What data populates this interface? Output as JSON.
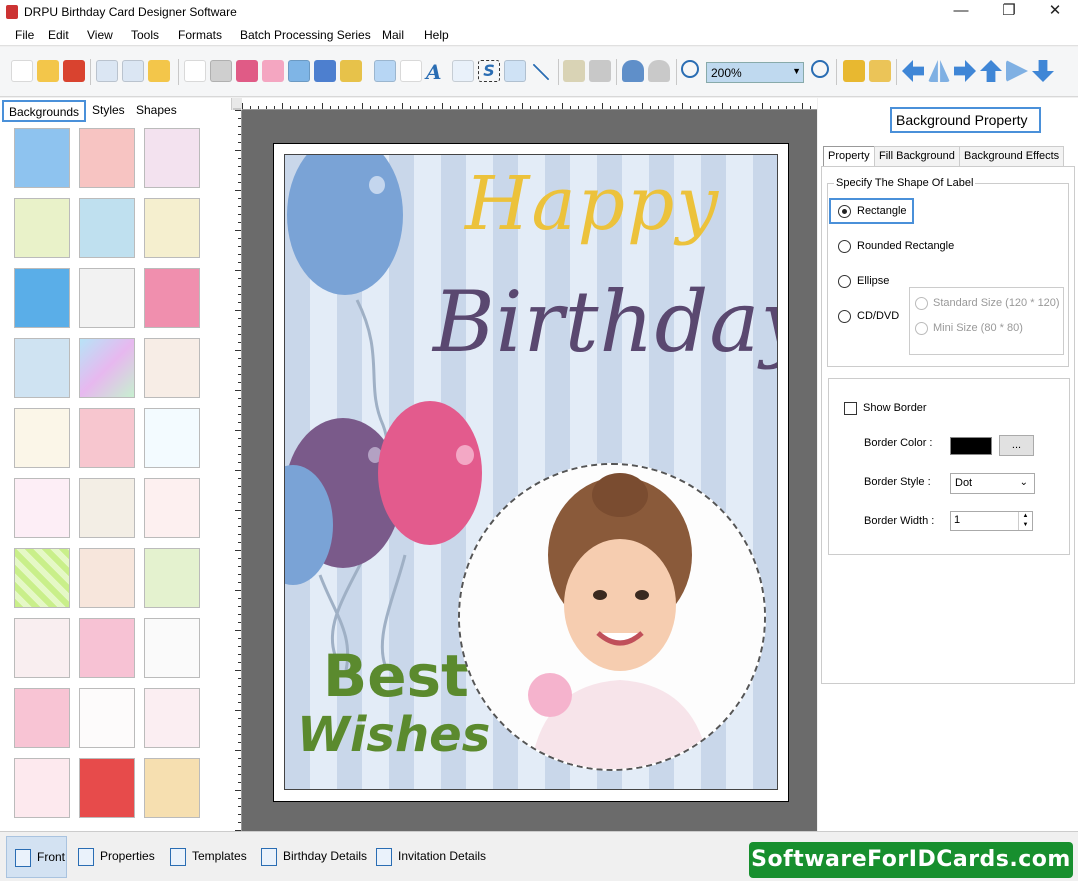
{
  "window": {
    "title": "DRPU Birthday Card Designer Software",
    "minimize": "—",
    "maximize": "❐",
    "close": "✕"
  },
  "menu": [
    "File",
    "Edit",
    "View",
    "Tools",
    "Formats",
    "Batch Processing Series",
    "Mail",
    "Help"
  ],
  "toolbar": {
    "zoom_value": "200%"
  },
  "left_panel": {
    "tabs": [
      "Backgrounds",
      "Styles",
      "Shapes"
    ],
    "active_tab": "Backgrounds"
  },
  "card": {
    "happy": "Happy",
    "birthday": "Birthday",
    "best": "Best",
    "wishes": "Wishes"
  },
  "right_panel": {
    "header": "Background Property",
    "tabs": [
      "Property",
      "Fill Background",
      "Background Effects"
    ],
    "shape_group_label": "Specify The Shape Of Label",
    "shape_options": [
      "Rectangle",
      "Rounded Rectangle",
      "Ellipse",
      "CD/DVD"
    ],
    "selected_shape": "Rectangle",
    "cd_sizes": [
      "Standard Size (120 * 120)",
      "Mini Size (80 * 80)"
    ],
    "show_border_label": "Show Border",
    "show_border_checked": false,
    "border_color_label": "Border Color :",
    "border_color": "#000000",
    "border_color_button": "...",
    "border_style_label": "Border Style :",
    "border_style_value": "Dot",
    "border_width_label": "Border Width :",
    "border_width_value": "1"
  },
  "bottom_tabs": [
    "Front",
    "Properties",
    "Templates",
    "Birthday Details",
    "Invitation Details"
  ],
  "active_bottom_tab": "Front",
  "brand": "SoftwareForIDCards.com"
}
